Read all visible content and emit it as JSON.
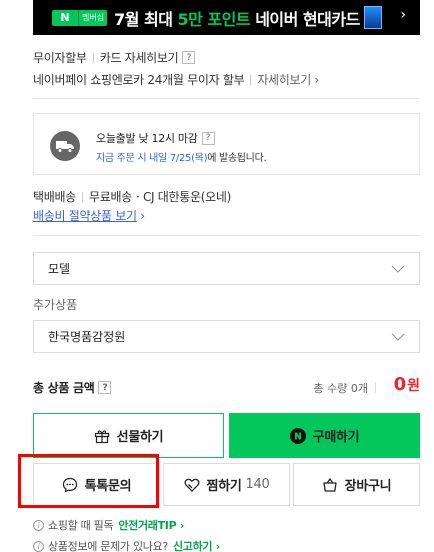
{
  "banner": {
    "badge_n": "N",
    "badge_membership": "멤버십",
    "text_pre": "7월 최대 ",
    "text_highlight": "5만 포인트",
    "text_post": " 네이버 현대카드",
    "arrow": "›"
  },
  "installment": {
    "no_interest_label": "무이자할부",
    "card_details_label": "카드 자세히보기",
    "help": "?",
    "naverpay_text": "네이버페이 쇼핑엔로카 24개월 무이자 할부",
    "details_label": "자세히보기 ›"
  },
  "shipping_box": {
    "dispatch_text": "오늘출발 낮 12시 마감",
    "help": "?",
    "order_blue": "지금 주문 시 내일 7/25(목)",
    "order_rest": "에 발송됩니다."
  },
  "delivery": {
    "type": "택배배송",
    "fee": "무료배송",
    "carrier": "· CJ 대한통운(오네)",
    "saving_link": "배송비 절약상품 보기",
    "saving_arrow": "›"
  },
  "options": {
    "model_select": "모델",
    "additional_label": "추가상품",
    "additional_select": "한국명품감정원"
  },
  "total": {
    "label": "총 상품 금액",
    "help": "?",
    "qty": "총 수량 0개",
    "price": "0",
    "currency": "원"
  },
  "actions": {
    "gift": "선물하기",
    "buy": "구매하기",
    "talk": "톡톡문의",
    "like": "찜하기",
    "like_count": "140",
    "cart": "장바구니"
  },
  "tips": {
    "tip1_text": "쇼핑할 때 필독",
    "tip1_link": "안전거래TIP ›",
    "tip2_text": "상품정보에 문제가 있나요?",
    "tip2_link": "신고하기 ›"
  },
  "colors": {
    "naver_green": "#03c75a",
    "price_red": "#f0222c",
    "link_blue": "#3563d6",
    "highlight_box": "#ff0000"
  }
}
